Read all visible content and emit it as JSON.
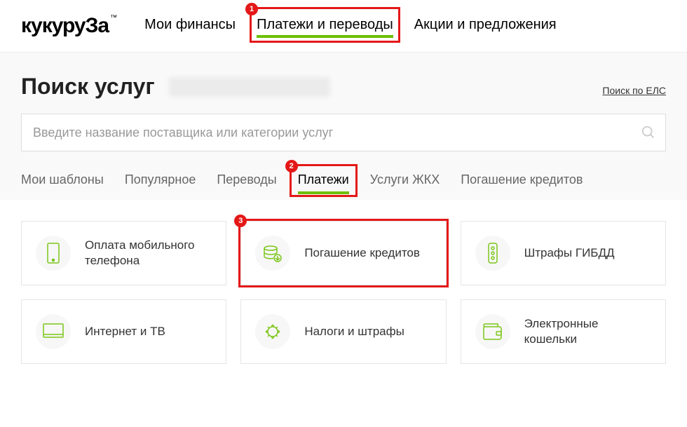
{
  "logo": "кукуруЗа",
  "logo_tm": "™",
  "nav": [
    {
      "label": "Мои финансы"
    },
    {
      "label": "Платежи и переводы",
      "active": true
    },
    {
      "label": "Акции и предложения"
    }
  ],
  "search": {
    "title": "Поиск услуг",
    "placeholder": "Введите название поставщика или категории услуг",
    "els_link": "Поиск по ЕЛС"
  },
  "tabs": [
    {
      "label": "Мои шаблоны"
    },
    {
      "label": "Популярное"
    },
    {
      "label": "Переводы"
    },
    {
      "label": "Платежи",
      "active": true
    },
    {
      "label": "Услуги ЖКХ"
    },
    {
      "label": "Погашение кредитов"
    }
  ],
  "cards": [
    {
      "label": "Оплата мобильного телефона",
      "icon": "phone"
    },
    {
      "label": "Погашение кредитов",
      "icon": "coins"
    },
    {
      "label": "Штрафы ГИБДД",
      "icon": "traffic-light"
    },
    {
      "label": "Интернет и ТВ",
      "icon": "monitor"
    },
    {
      "label": "Налоги и штрафы",
      "icon": "emblem"
    },
    {
      "label": "Электронные кошельки",
      "icon": "wallet"
    }
  ],
  "annotations": {
    "badge1": "1",
    "badge2": "2",
    "badge3": "3"
  }
}
